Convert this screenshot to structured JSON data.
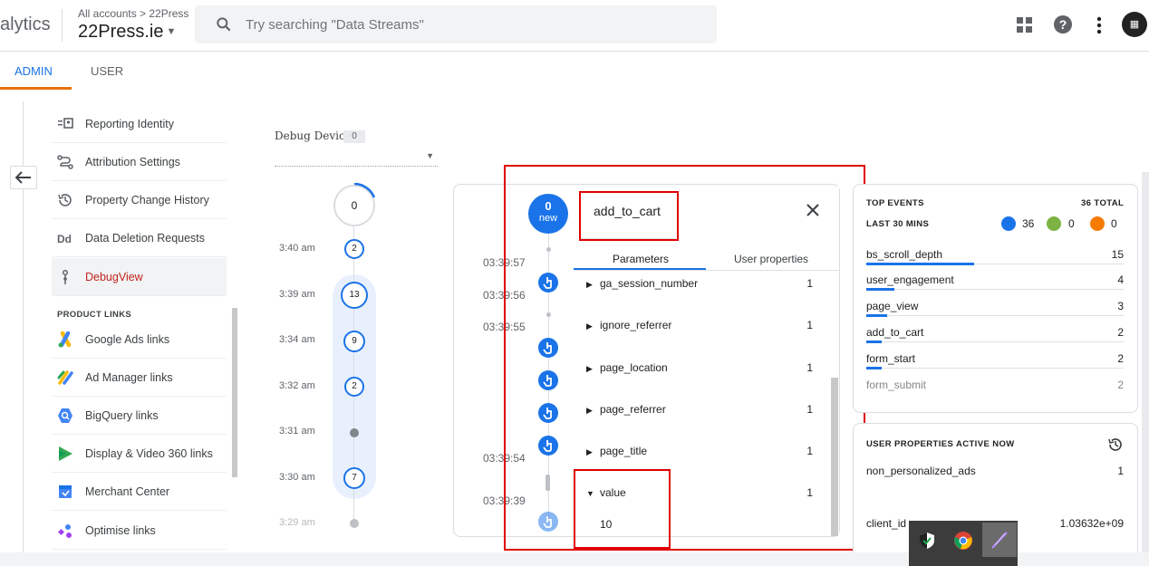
{
  "header": {
    "brand": "alytics",
    "breadcrumb": "All accounts > 22Press",
    "account": "22Press.ie",
    "search_placeholder": "Try searching \"Data Streams\""
  },
  "tabs": {
    "admin": "ADMIN",
    "user": "USER"
  },
  "sidebar": {
    "items": [
      {
        "label": "Reporting Identity",
        "icon": "reporting-identity-icon"
      },
      {
        "label": "Attribution Settings",
        "icon": "attribution-icon"
      },
      {
        "label": "Property Change History",
        "icon": "history-icon"
      },
      {
        "label": "Data Deletion Requests",
        "icon": "dd-icon"
      },
      {
        "label": "DebugView",
        "icon": "debug-icon",
        "active": true
      }
    ],
    "product_links_heading": "PRODUCT LINKS",
    "product_links": [
      {
        "label": "Google Ads links",
        "icon": "google-ads-icon"
      },
      {
        "label": "Ad Manager links",
        "icon": "ad-manager-icon"
      },
      {
        "label": "BigQuery links",
        "icon": "bigquery-icon"
      },
      {
        "label": "Display & Video 360 links",
        "icon": "dv360-icon"
      },
      {
        "label": "Merchant Center",
        "icon": "merchant-center-icon"
      },
      {
        "label": "Optimise links",
        "icon": "optimise-icon"
      }
    ]
  },
  "debug_device": {
    "label": "Debug Device",
    "count": "0"
  },
  "minutes": {
    "top": "0",
    "rows": [
      {
        "time": "3:40 am",
        "count": "2"
      },
      {
        "time": "3:39 am",
        "count": "13"
      },
      {
        "time": "3:34 am",
        "count": "9"
      },
      {
        "time": "3:32 am",
        "count": "2"
      },
      {
        "time": "3:31 am",
        "count": ""
      },
      {
        "time": "3:30 am",
        "count": "7"
      },
      {
        "time": "3:29 am",
        "count": ""
      }
    ]
  },
  "seconds": {
    "new_count": "0",
    "new_label": "new",
    "times": [
      "03:39:57",
      "03:39:56",
      "03:39:55",
      "03:39:54",
      "03:39:39"
    ]
  },
  "event_details": {
    "title": "add_to_cart",
    "tab_parameters": "Parameters",
    "tab_user_properties": "User properties",
    "params": [
      {
        "name": "ga_session_number",
        "count": "1",
        "expanded": false
      },
      {
        "name": "ignore_referrer",
        "count": "1",
        "expanded": false
      },
      {
        "name": "page_location",
        "count": "1",
        "expanded": false
      },
      {
        "name": "page_referrer",
        "count": "1",
        "expanded": false
      },
      {
        "name": "page_title",
        "count": "1",
        "expanded": false
      },
      {
        "name": "value",
        "count": "1",
        "expanded": true
      }
    ],
    "value_expanded": "10"
  },
  "top_events": {
    "heading": "TOP EVENTS",
    "total": "36 TOTAL",
    "period": "LAST 30 MINS",
    "stats": {
      "events": "36",
      "conversions": "0",
      "errors": "0"
    },
    "rows": [
      {
        "name": "bs_scroll_depth",
        "count": "15",
        "share": 0.42
      },
      {
        "name": "user_engagement",
        "count": "4",
        "share": 0.11
      },
      {
        "name": "page_view",
        "count": "3",
        "share": 0.08
      },
      {
        "name": "add_to_cart",
        "count": "2",
        "share": 0.06
      },
      {
        "name": "form_start",
        "count": "2",
        "share": 0.06
      },
      {
        "name": "form_submit",
        "count": "2",
        "share": 0.06
      }
    ]
  },
  "user_properties": {
    "heading": "USER PROPERTIES ACTIVE NOW",
    "rows": [
      {
        "name": "non_personalized_ads",
        "value": "1"
      },
      {
        "name": "client_id",
        "value": "1.03632e+09"
      }
    ]
  },
  "colors": {
    "accent": "#1a73e8",
    "active_nav": "#c5221f",
    "tab_underline": "#e8710a",
    "annotation": "#e00000"
  }
}
